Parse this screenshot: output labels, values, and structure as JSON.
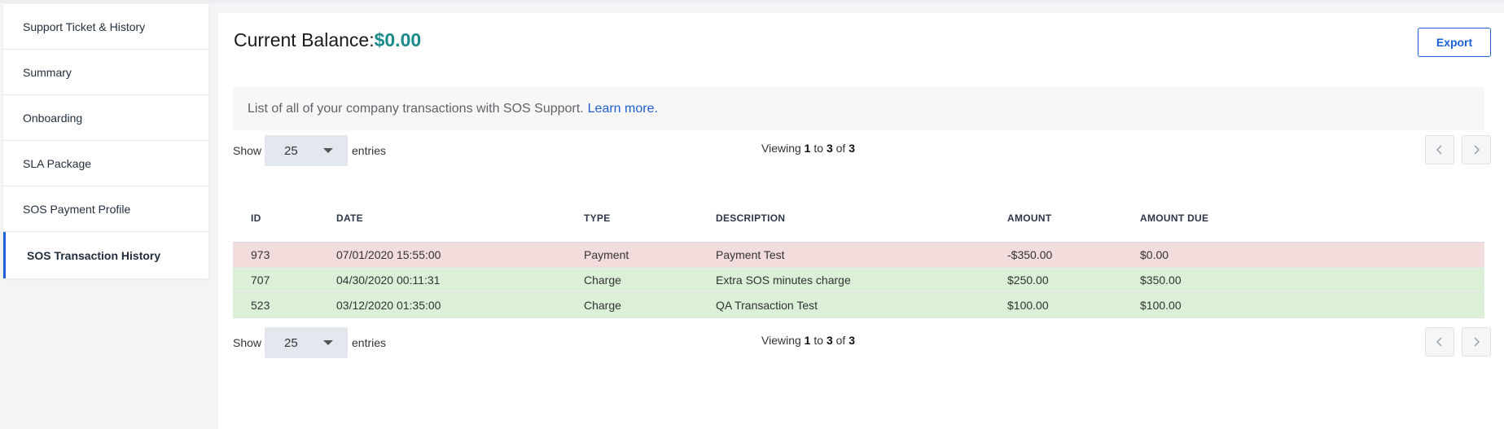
{
  "sidebar": {
    "items": [
      {
        "label": "Support Ticket & History"
      },
      {
        "label": "Summary"
      },
      {
        "label": "Onboarding"
      },
      {
        "label": "SLA Package"
      },
      {
        "label": "SOS Payment Profile"
      },
      {
        "label": "SOS Transaction History"
      }
    ],
    "active_index": 5
  },
  "header": {
    "balance_label": "Current Balance:",
    "balance_value": "$0.00",
    "export_label": "Export"
  },
  "info": {
    "text": "List of all of your company transactions with SOS Support.",
    "link_text": "Learn more",
    "link_suffix": "."
  },
  "pagination": {
    "show_label": "Show",
    "page_size": "25",
    "entries_label": "entries",
    "viewing_prefix": "Viewing",
    "from": "1",
    "to_word": "to",
    "to": "3",
    "of_word": "of",
    "total": "3",
    "prev_icon": "chevron-left-icon",
    "next_icon": "chevron-right-icon"
  },
  "table": {
    "columns": [
      "ID",
      "DATE",
      "TYPE",
      "DESCRIPTION",
      "AMOUNT",
      "AMOUNT DUE"
    ],
    "rows": [
      {
        "id": "973",
        "date": "07/01/2020 15:55:00",
        "type": "Payment",
        "description": "Payment Test",
        "amount": "-$350.00",
        "amount_due": "$0.00"
      },
      {
        "id": "707",
        "date": "04/30/2020 00:11:31",
        "type": "Charge",
        "description": "Extra SOS minutes charge",
        "amount": "$250.00",
        "amount_due": "$350.00"
      },
      {
        "id": "523",
        "date": "03/12/2020 01:35:00",
        "type": "Charge",
        "description": "QA Transaction Test",
        "amount": "$100.00",
        "amount_due": "$100.00"
      }
    ]
  },
  "colors": {
    "accent": "#1d5fd6",
    "balance": "#1a8a8a",
    "payment_row": "#f2dcdc",
    "charge_row": "#dcefd7"
  }
}
